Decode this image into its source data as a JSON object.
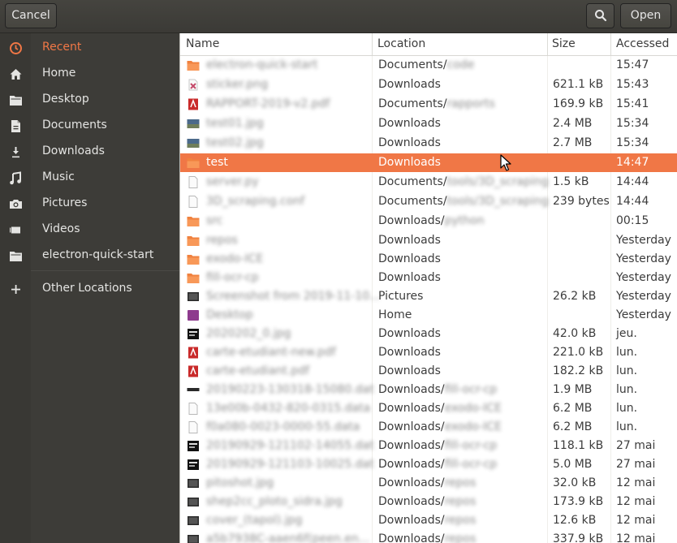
{
  "header": {
    "cancel_label": "Cancel",
    "open_label": "Open",
    "search_icon": "search-icon"
  },
  "sidebar": {
    "items": [
      {
        "label": "Recent",
        "icon": "clock-icon",
        "active": true
      },
      {
        "label": "Home",
        "icon": "home-icon"
      },
      {
        "label": "Desktop",
        "icon": "folder-icon"
      },
      {
        "label": "Documents",
        "icon": "document-icon"
      },
      {
        "label": "Downloads",
        "icon": "download-icon"
      },
      {
        "label": "Music",
        "icon": "music-icon"
      },
      {
        "label": "Pictures",
        "icon": "camera-icon"
      },
      {
        "label": "Videos",
        "icon": "video-icon"
      },
      {
        "label": "electron-quick-start",
        "icon": "folder-icon"
      }
    ],
    "other_locations_label": "Other Locations"
  },
  "columns": {
    "name": "Name",
    "location": "Location",
    "size": "Size",
    "accessed": "Accessed"
  },
  "colors": {
    "accent": "#f07746",
    "sidebar_bg": "#3d3c38",
    "header_bg": "#3f3e3a"
  },
  "files": [
    {
      "icon": "folder",
      "name": "electron-quick-start",
      "location": "Documents/",
      "location_sub": "code",
      "size": "",
      "accessed": "15:47",
      "blurred": true
    },
    {
      "icon": "image-pink",
      "name": "sticker.png",
      "location": "Downloads",
      "location_sub": "",
      "size": "621.1 kB",
      "accessed": "15:43",
      "blurred": true
    },
    {
      "icon": "pdf",
      "name": "RAPPORT-2019-v2.pdf",
      "location": "Documents/",
      "location_sub": "rapports",
      "size": "169.9 kB",
      "accessed": "15:41",
      "blurred": true
    },
    {
      "icon": "image-photo",
      "name": "test01.jpg",
      "location": "Downloads",
      "location_sub": "",
      "size": "2.4 MB",
      "accessed": "15:34",
      "blurred": true
    },
    {
      "icon": "image-photo",
      "name": "test02.jpg",
      "location": "Downloads",
      "location_sub": "",
      "size": "2.7 MB",
      "accessed": "15:34",
      "blurred": true
    },
    {
      "icon": "folder",
      "name": "test",
      "location": "Downloads",
      "location_sub": "",
      "size": "",
      "accessed": "14:47",
      "blurred": false,
      "selected": true
    },
    {
      "icon": "text",
      "name": "server.py",
      "location": "Documents/",
      "location_sub": "tools/3D_scraping",
      "size": "1.5 kB",
      "accessed": "14:44",
      "blurred": true
    },
    {
      "icon": "text",
      "name": "3D_scraping.conf",
      "location": "Documents/",
      "location_sub": "tools/3D_scraping",
      "size": "239 bytes",
      "accessed": "14:44",
      "blurred": true
    },
    {
      "icon": "folder",
      "name": "src",
      "location": "Downloads/",
      "location_sub": "python",
      "size": "",
      "accessed": "00:15",
      "blurred": true
    },
    {
      "icon": "folder",
      "name": "repos",
      "location": "Downloads",
      "location_sub": "",
      "size": "",
      "accessed": "Yesterday",
      "blurred": true
    },
    {
      "icon": "folder",
      "name": "exodo-ICE",
      "location": "Downloads",
      "location_sub": "",
      "size": "",
      "accessed": "Yesterday",
      "blurred": true
    },
    {
      "icon": "folder",
      "name": "fill-ocr-cp",
      "location": "Downloads",
      "location_sub": "",
      "size": "",
      "accessed": "Yesterday",
      "blurred": true
    },
    {
      "icon": "screen",
      "name": "Screenshot from 2019-11-10...",
      "location": "Pictures",
      "location_sub": "",
      "size": "26.2 kB",
      "accessed": "Yesterday",
      "blurred": true
    },
    {
      "icon": "purple",
      "name": "Desktop",
      "location": "Home",
      "location_sub": "",
      "size": "",
      "accessed": "Yesterday",
      "blurred": true
    },
    {
      "icon": "image-dark",
      "name": "2020202_0.jpg",
      "location": "Downloads",
      "location_sub": "",
      "size": "42.0 kB",
      "accessed": "jeu.",
      "blurred": true
    },
    {
      "icon": "pdf",
      "name": "carte-etudiant-new.pdf",
      "location": "Downloads",
      "location_sub": "",
      "size": "221.0 kB",
      "accessed": "lun.",
      "blurred": true
    },
    {
      "icon": "pdf",
      "name": "carte-etudiant.pdf",
      "location": "Downloads",
      "location_sub": "",
      "size": "182.2 kB",
      "accessed": "lun.",
      "blurred": true
    },
    {
      "icon": "screen-thin",
      "name": "20190223-130318-15080.dat",
      "location": "Downloads/",
      "location_sub": "fill-ocr-cp",
      "size": "1.9 MB",
      "accessed": "lun.",
      "blurred": true
    },
    {
      "icon": "text",
      "name": "13e00b-0432-820-0315.data",
      "location": "Downloads/",
      "location_sub": "exodo-ICE",
      "size": "6.2 MB",
      "accessed": "lun.",
      "blurred": true
    },
    {
      "icon": "text",
      "name": "f0a080-0023-0000-55.data",
      "location": "Downloads/",
      "location_sub": "exodo-ICE",
      "size": "6.2 MB",
      "accessed": "lun.",
      "blurred": true
    },
    {
      "icon": "image-dark",
      "name": "20190929-121102-14055.dat",
      "location": "Downloads/",
      "location_sub": "fill-ocr-cp",
      "size": "118.1 kB",
      "accessed": "27 mai",
      "blurred": true
    },
    {
      "icon": "image-dark",
      "name": "20190929-121103-10025.dat",
      "location": "Downloads/",
      "location_sub": "fill-ocr-cp",
      "size": "5.0 MB",
      "accessed": "27 mai",
      "blurred": true
    },
    {
      "icon": "screen",
      "name": "pitoshot.jpg",
      "location": "Downloads/",
      "location_sub": "repos",
      "size": "32.0 kB",
      "accessed": "12 mai",
      "blurred": true
    },
    {
      "icon": "screen",
      "name": "shep2cc_ploto_sidra.jpg",
      "location": "Downloads/",
      "location_sub": "repos",
      "size": "173.9 kB",
      "accessed": "12 mai",
      "blurred": true
    },
    {
      "icon": "screen",
      "name": "cover_(tapol).jpg",
      "location": "Downloads/",
      "location_sub": "repos",
      "size": "12.6 kB",
      "accessed": "12 mai",
      "blurred": true
    },
    {
      "icon": "screen",
      "name": "a5b7938C-aaen6f(peen.en...",
      "location": "Downloads/",
      "location_sub": "repos",
      "size": "337.9 kB",
      "accessed": "12 mai",
      "blurred": true
    }
  ]
}
